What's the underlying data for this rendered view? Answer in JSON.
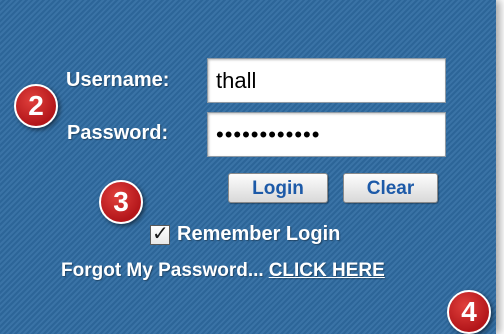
{
  "colors": {
    "panel_background": "#2e6aa0",
    "button_text": "#1d5aa8",
    "marker_fill": "#c8201f"
  },
  "login_form": {
    "username_label": "Username:",
    "username_value": "thall",
    "password_label": "Password:",
    "password_value": "••••••••••••",
    "login_button": "Login",
    "clear_button": "Clear",
    "remember_checked": true,
    "remember_label": "Remember Login",
    "forgot_text": "Forgot My Password...",
    "forgot_link": "CLICK HERE"
  },
  "markers": [
    {
      "label": "2"
    },
    {
      "label": "3"
    },
    {
      "label": "4"
    }
  ]
}
